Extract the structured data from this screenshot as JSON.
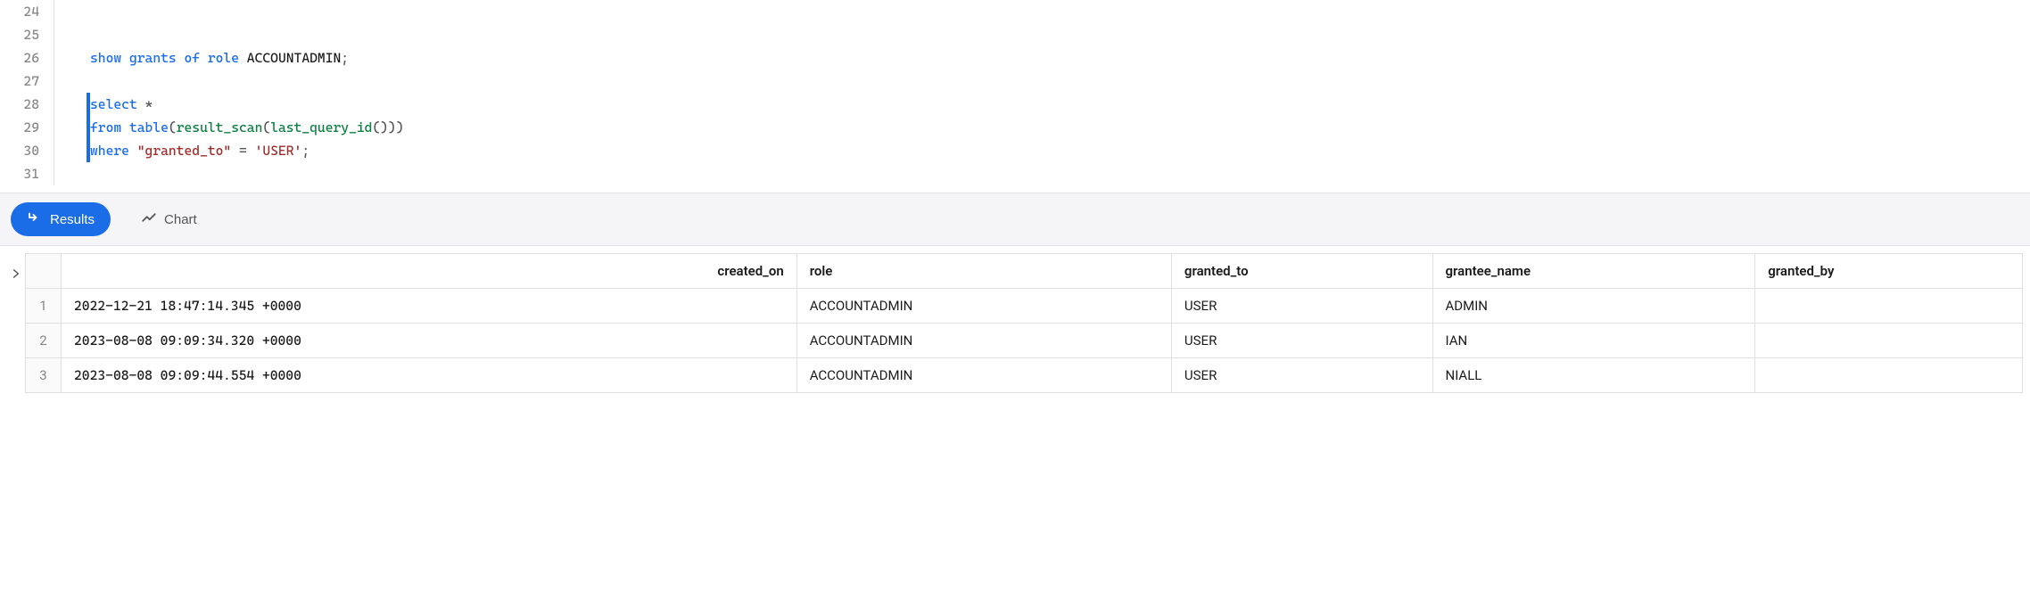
{
  "editor": {
    "lines": [
      {
        "num": "24",
        "tokens": []
      },
      {
        "num": "25",
        "tokens": []
      },
      {
        "num": "26",
        "tokens": [
          {
            "t": "show grants of role",
            "c": "kw"
          },
          {
            "t": " ",
            "c": "plain"
          },
          {
            "t": "ACCOUNTADMIN",
            "c": "plain"
          },
          {
            "t": ";",
            "c": "op"
          }
        ]
      },
      {
        "num": "27",
        "tokens": []
      },
      {
        "num": "28",
        "active": true,
        "tokens": [
          {
            "t": "select",
            "c": "kw"
          },
          {
            "t": " ",
            "c": "plain"
          },
          {
            "t": "*",
            "c": "op"
          }
        ]
      },
      {
        "num": "29",
        "active": true,
        "tokens": [
          {
            "t": "from",
            "c": "kw"
          },
          {
            "t": " ",
            "c": "plain"
          },
          {
            "t": "table",
            "c": "kw"
          },
          {
            "t": "(",
            "c": "op"
          },
          {
            "t": "result_scan",
            "c": "fn"
          },
          {
            "t": "(",
            "c": "op"
          },
          {
            "t": "last_query_id",
            "c": "fn"
          },
          {
            "t": "()))",
            "c": "op"
          }
        ]
      },
      {
        "num": "30",
        "active": true,
        "tokens": [
          {
            "t": "where",
            "c": "kw"
          },
          {
            "t": " ",
            "c": "plain"
          },
          {
            "t": "\"granted_to\"",
            "c": "str"
          },
          {
            "t": " ",
            "c": "plain"
          },
          {
            "t": "=",
            "c": "op"
          },
          {
            "t": " ",
            "c": "plain"
          },
          {
            "t": "'USER'",
            "c": "str"
          },
          {
            "t": ";",
            "c": "op"
          }
        ]
      },
      {
        "num": "31",
        "tokens": []
      }
    ]
  },
  "tabs": {
    "results_label": "Results",
    "chart_label": "Chart"
  },
  "results": {
    "columns": [
      "created_on",
      "role",
      "granted_to",
      "grantee_name",
      "granted_by"
    ],
    "rows": [
      {
        "n": "1",
        "created_on": "2022-12-21 18:47:14.345 +0000",
        "role": "ACCOUNTADMIN",
        "granted_to": "USER",
        "grantee_name": "ADMIN",
        "granted_by": ""
      },
      {
        "n": "2",
        "created_on": "2023-08-08 09:09:34.320 +0000",
        "role": "ACCOUNTADMIN",
        "granted_to": "USER",
        "grantee_name": "IAN",
        "granted_by": ""
      },
      {
        "n": "3",
        "created_on": "2023-08-08 09:09:44.554 +0000",
        "role": "ACCOUNTADMIN",
        "granted_to": "USER",
        "grantee_name": "NIALL",
        "granted_by": ""
      }
    ]
  }
}
